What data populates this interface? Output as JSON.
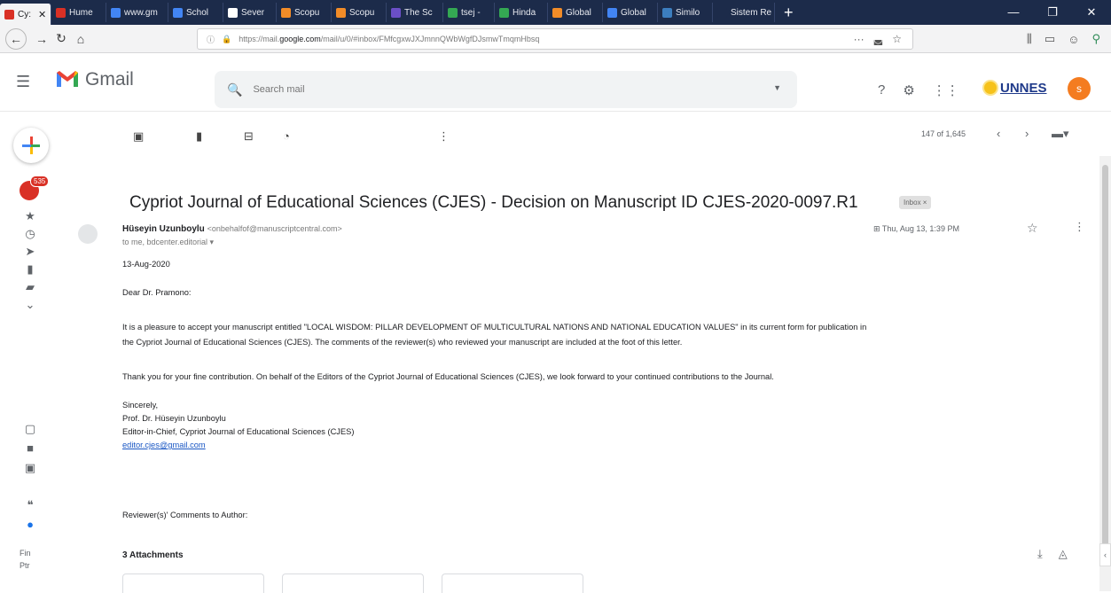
{
  "browser": {
    "tabs": [
      {
        "label": "Cy: ",
        "color": "#d93025",
        "active": true
      },
      {
        "label": "Hume",
        "color": "#d93025"
      },
      {
        "label": "www.gm",
        "color": "#4285f4"
      },
      {
        "label": "Schol",
        "color": "#4285f4"
      },
      {
        "label": "Sever",
        "color": "#ffffff"
      },
      {
        "label": "Scopu",
        "color": "#f28c28"
      },
      {
        "label": "Scopu",
        "color": "#f28c28"
      },
      {
        "label": "The Sc",
        "color": "#6b4fc7"
      },
      {
        "label": "tsej -",
        "color": "#34a853"
      },
      {
        "label": "Hinda",
        "color": "#34a853"
      },
      {
        "label": "Global",
        "color": "#f28c28"
      },
      {
        "label": "Global",
        "color": "#4285f4"
      },
      {
        "label": "Similo",
        "color": "#3c7ebf"
      },
      {
        "label": "Sistem Re",
        "color": "#1c2b4a"
      }
    ],
    "new_tab": "+",
    "url": {
      "prefix": "https://mail.",
      "domain": "google.com",
      "path": "/mail/u/0/#inbox/FMfcgxwJXJmnnQWbWgfDJsmwTmqmHbsq"
    }
  },
  "gmail": {
    "brand": "Gmail",
    "search_placeholder": "Search mail",
    "org_name": "UNNES",
    "avatar_initial": "s"
  },
  "rail": {
    "inbox_count": "535",
    "meet_label": "Fin",
    "meet_label2": "Ptr"
  },
  "toolbar": {
    "pager": "147 of 1,645"
  },
  "message": {
    "subject": "Cypriot Journal of Educational Sciences (CJES) - Decision on Manuscript ID CJES-2020-0097.R1",
    "label": "Inbox ×",
    "sender_name": "Hüseyin Uzunboylu",
    "sender_email": "<onbehalfof@manuscriptcentral.com>",
    "recipients": "to me, bdcenter.editorial ▾",
    "date": "Thu, Aug 13, 1:39 PM",
    "body": {
      "date_line": "13-Aug-2020",
      "greeting": "Dear Dr. Pramono:",
      "p1_line1": "It is a pleasure to accept your manuscript entitled \"LOCAL WISDOM: PILLAR DEVELOPMENT OF MULTICULTURAL NATIONS AND NATIONAL EDUCATION VALUES\" in its current form for publication in",
      "p1_line2": "the Cypriot Journal of Educational Sciences (CJES).  The comments of the reviewer(s) who reviewed your manuscript are included at the foot of this letter.",
      "p2": "Thank you for your fine contribution.  On behalf of the Editors of the Cypriot Journal of Educational Sciences (CJES), we look forward to your continued contributions to the Journal.",
      "sign1": "Sincerely,",
      "sign2": "Prof. Dr. Hüseyin Uzunboylu",
      "sign3": "Editor-in-Chief, Cypriot Journal of Educational Sciences (CJES)",
      "email": "editor.cjes@gmail.com",
      "reviewer": "Reviewer(s)' Comments to Author:"
    },
    "attachments_title": "3 Attachments"
  }
}
